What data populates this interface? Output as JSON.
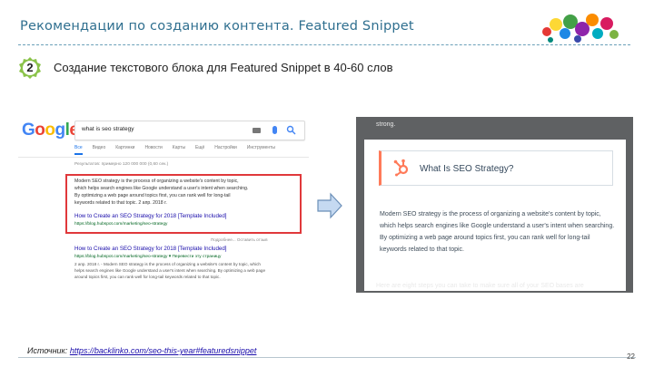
{
  "slide": {
    "title": "Рекомендации по созданию контента. Featured Snippet",
    "step_number": "2",
    "step_text": "Создание текстового блока для Featured Snippet в 40-60 слов",
    "page_number": "22"
  },
  "source": {
    "label": "Источник:",
    "url": "https://backlinko.com/seo-this-year#featuredsnippet"
  },
  "google_serp": {
    "logo": [
      "G",
      "o",
      "o",
      "g",
      "l",
      "e"
    ],
    "logo_colors": [
      "#4285f4",
      "#ea4335",
      "#fbbc05",
      "#4285f4",
      "#34a853",
      "#ea4335"
    ],
    "query": "what is seo strategy",
    "tabs": [
      "Все",
      "Видео",
      "Картинки",
      "Новости",
      "Карты",
      "Ещё",
      "Настройки",
      "Инструменты"
    ],
    "stats": "Результатов: примерно 120 000 000 (0,60 сек.)",
    "snippet_lines": [
      "Modern SEO strategy is the process of organizing a website's content by topic,",
      "which helps search engines like Google understand a user's intent when searching.",
      "By optimizing a web page around topics first, you can rank well for long-tail",
      "keywords related to that topic. 2 апр. 2018 г."
    ],
    "featured_link": "How to Create an SEO Strategy for 2018 [Template Included]",
    "featured_url": "https://blog.hubspot.com/marketing/seo-strategy",
    "feedback": "Подробнее...   Оставить отзыв",
    "second_link": "How to Create an SEO Strategy for 2018 [Template Included]",
    "second_url": "https://blog.hubspot.com/marketing/seo-strategy ▾ Перевести эту страницу",
    "second_lines": [
      "2 апр. 2018 г. - Modern SEO strategy is the process of organizing a website's content by topic, which",
      "helps search engines like Google understand a user's intent when searching. By optimizing a web page",
      "around topics first, you can rank well for long-tail keywords related to that topic."
    ]
  },
  "hubspot": {
    "top_text": "strong.",
    "heading": "What Is SEO Strategy?",
    "body": "Modern SEO strategy is the process of organizing a website's content by topic, which helps search engines like Google understand a user's intent when searching. By optimizing a web page around topics first, you can rank well for long-tail keywords related to that topic.",
    "bottom_text": "Here are eight steps you can take to make sure all of your SEO bases are"
  }
}
